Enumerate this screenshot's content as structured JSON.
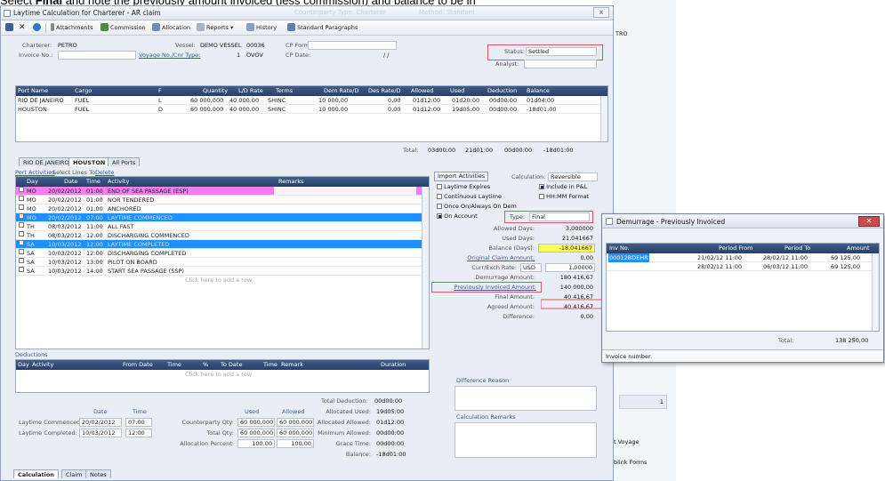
{
  "caption": {
    "pre": "Select ",
    "bold": "Final",
    "post": " and note the previously amount invoiced (less commission) and balance to be in"
  },
  "window": {
    "title": "Laytime Calculation for Charterer - AR claim",
    "ghost1": "Counterparty Type: Charterer",
    "ghost2": "Method: Standard",
    "close": "x"
  },
  "toolbar": {
    "attachments": "Attachments",
    "commission": "Commission",
    "allocation": "Allocation",
    "reports": "Reports",
    "history": "History",
    "paragraphs": "Standard Paragraphs"
  },
  "header": {
    "charterer_label": "Charterer:",
    "charterer": "PETRO",
    "invoice_label": "Invoice No.:",
    "vessel_label": "Vessel:",
    "vessel": "DEMO VESSEL",
    "vessel_no": "00036",
    "voyage_label": "Voyage No./Cnr Type:",
    "voyage": "1",
    "voyage_type": "OVOV",
    "cpform_label": "CP Form:",
    "cpdate_label": "CP Date:",
    "cpdate": "/ /",
    "status_label": "Status:",
    "status": "Settled",
    "analyst_label": "Analyst:"
  },
  "ports": {
    "headers": [
      "Port Name",
      "Cargo",
      "F",
      "Quantity",
      "L/D Rate",
      "Terms",
      "Dem Rate/D",
      "Des Rate/D",
      "Allowed",
      "Used",
      "Deduction",
      "Balance"
    ],
    "rows": [
      [
        "RIO DE JANEIRO",
        "FUEL",
        "L",
        "60 000,000",
        "40 000,00",
        "SHINC",
        "10 000,00",
        "0,00",
        "01d12:00",
        "01d20:00",
        "00d00:00",
        "01d04:00"
      ],
      [
        "HOUSTON",
        "FUEL",
        "D",
        "60 000,000",
        "40 000,00",
        "SHINC",
        "10 000,00",
        "0,00",
        "01d12:00",
        "19d05:00",
        "00d00:00",
        "-18d01:00"
      ]
    ],
    "total_label": "Total:",
    "totals": [
      "03d00:00",
      "21d01:00",
      "00d00:00",
      "-18d01:00"
    ]
  },
  "tabs": [
    "RIO DE JANEIRO",
    "HOUSTON",
    "All Ports"
  ],
  "activities": {
    "port_activities": "Port Activities",
    "select_lines": "Select Lines To:",
    "delete": "Delete",
    "headers": [
      "Day",
      "Date",
      "Time",
      "Activity",
      "Remarks"
    ],
    "rows": [
      [
        "MO",
        "20/02/2012",
        "01:00",
        "END OF SEA PASSAGE (ESP)"
      ],
      [
        "MO",
        "20/02/2012",
        "01:00",
        "NOR TENDERED"
      ],
      [
        "MO",
        "20/02/2012",
        "01:00",
        "ANCHORED"
      ],
      [
        "MO",
        "20/02/2012",
        "07:00",
        "LAYTIME COMMENCED"
      ],
      [
        "TH",
        "08/03/2012",
        "11:00",
        "ALL FAST"
      ],
      [
        "TH",
        "08/03/2012",
        "12:00",
        "DISCHARGING COMMENCED"
      ],
      [
        "SA",
        "10/03/2012",
        "12:00",
        "LAYTIME COMPLETED"
      ],
      [
        "SA",
        "10/03/2012",
        "12:00",
        "DISCHARGING COMPLETED"
      ],
      [
        "SA",
        "10/03/2012",
        "13:00",
        "PILOT ON BOARD"
      ],
      [
        "SA",
        "10/03/2012",
        "14:00",
        "START SEA PASSAGE (SSP)"
      ]
    ],
    "add_row": "Click here to add a row"
  },
  "right": {
    "import": "Import Activities",
    "calc_label": "Calculation:",
    "calc": "Reversible",
    "laytime_expires": "Laytime Expires",
    "include_pnl": "Include in P&L",
    "continuous": "Continuous Laytime",
    "hhmm": "HH:MM Format",
    "once_on": "Once On/Always On Dem",
    "on_account": "On Account",
    "type_label": "Type:",
    "type": "Final",
    "allowed_days_label": "Allowed Days:",
    "allowed_days": "3,000000",
    "used_days_label": "Used Days:",
    "used_days": "21,041667",
    "balance_label": "Balance (Days):",
    "balance": "-18,041667",
    "orig_label": "Original Claim Amount:",
    "orig": "0,00",
    "curr_label": "Curr/Exch Rate:",
    "curr": "USD",
    "rate": "1,00000",
    "dem_label": "Demurrage Amount:",
    "dem": "180 416,67",
    "prev_label": "Previously Invoiced Amount:",
    "prev": "140 000,00",
    "final_label": "Final Amount:",
    "final": "40 416,67",
    "agreed_label": "Agreed Amount:",
    "agreed": "40 416,67",
    "diff_label": "Difference:",
    "diff": "0,00",
    "diff_reason": "Difference Reason",
    "calc_remarks": "Calculation Remarks"
  },
  "deductions": {
    "title": "Deductions",
    "headers": [
      "Day",
      "Activity",
      "From Date",
      "Time",
      "%",
      "To Date",
      "Time",
      "Remark",
      "Duration"
    ],
    "add_row": "Click here to add a row",
    "total_label": "Total Deduction:",
    "total": "00d00:00"
  },
  "summary": {
    "date_h": "Date",
    "time_h": "Time",
    "commenced_label": "Laytime Commenced:",
    "commenced_date": "20/02/2012",
    "commenced_time": "07:00",
    "completed_label": "Laytime Completed:",
    "completed_date": "10/03/2012",
    "completed_time": "12:00",
    "used_h": "Used",
    "allowed_h": "Allowed",
    "cp_qty_label": "Counterparty Qty:",
    "cp_qty_used": "60 000,000",
    "cp_qty_allowed": "60 000,000",
    "total_qty_label": "Total Qty:",
    "total_qty_used": "60 000,000",
    "total_qty_allowed": "60 000,000",
    "alloc_pct_label": "Allocation Percent:",
    "alloc_used": "100,00",
    "alloc_allowed": "100,00",
    "alloc_used_label": "Allocated Used:",
    "alloc_used_v": "19d05:00",
    "alloc_allowed_label": "Allocated Allowed:",
    "alloc_allowed_v": "01d12:00",
    "min_allowed_label": "Minimum Allowed:",
    "min_allowed_v": "00d00:00",
    "grace_label": "Grace Time:",
    "grace_v": "00d00:00",
    "balance_label": "Balance:",
    "balance_v": "-18d01:00"
  },
  "bottom_tabs": [
    "Calculation",
    "Claim",
    "Notes"
  ],
  "popup": {
    "title": "Demurrage - Previously Invoiced",
    "headers": [
      "Inv No.",
      "Period From",
      "Period To",
      "Amount"
    ],
    "rows": [
      [
        "00012BDEHR",
        "21/02/12 11:00",
        "28/02/12 11:00",
        "69 125,00"
      ],
      [
        "",
        "28/02/12 11:00",
        "06/03/12 11:00",
        "69 125,00"
      ]
    ],
    "total_label": "Total:",
    "total": "138 250,00",
    "footer": "Invoice number."
  },
  "side": {
    "tro": "TRO",
    "one": "1",
    "voyage": "t Voyage",
    "forms": "blink Forms"
  },
  "colors": {
    "pink": "#f27ff2",
    "blue": "#1e90ff",
    "yellow": "#ffff55",
    "red": "#e05566"
  }
}
